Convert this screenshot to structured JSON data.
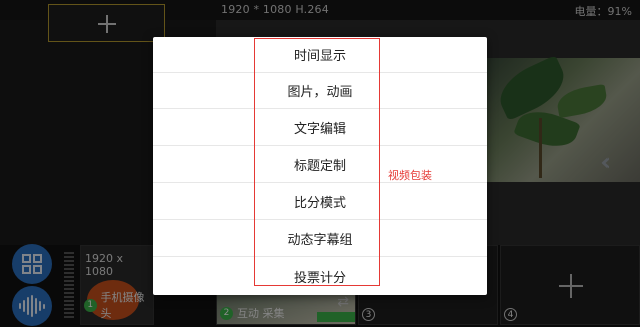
{
  "topbar": {
    "resolution": "1920 * 1080 H.264",
    "battery": "电量：91%"
  },
  "menu": {
    "items": [
      {
        "label": "时间显示"
      },
      {
        "label": "图片，动画"
      },
      {
        "label": "文字编辑"
      },
      {
        "label": "标题定制"
      },
      {
        "label": "比分模式"
      },
      {
        "label": "动态字幕组"
      },
      {
        "label": "投票计分"
      }
    ]
  },
  "annotation": {
    "text": "视频包装",
    "color": "#e53935"
  },
  "sources": [
    {
      "number": "1",
      "resolution": "1920 x 1080",
      "label": "手机摄像头"
    },
    {
      "number": "2",
      "label": "互动 采集"
    },
    {
      "number": "3",
      "label": ""
    },
    {
      "number": "4",
      "label": ""
    }
  ],
  "icons": {
    "add": "plus-icon",
    "layout": "grid-layout-icon",
    "audio": "audio-wave-icon",
    "collapse": "double-chevron-left-icon",
    "switch": "swap-icon"
  },
  "colors": {
    "accent_blue": "#2a6fbf",
    "live_green": "#3bb24a",
    "source_border": "#b59a2e"
  }
}
